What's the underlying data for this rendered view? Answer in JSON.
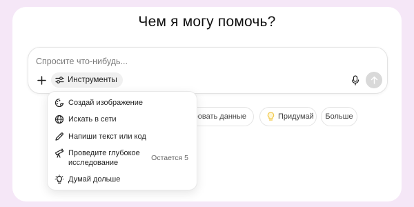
{
  "heading": "Чем я могу помочь?",
  "composer": {
    "placeholder": "Спросите что-нибудь...",
    "tools_label": "Инструменты"
  },
  "chips": {
    "analyze": "зировать данные",
    "invent": "Придумай",
    "more": "Больше"
  },
  "tools_menu": {
    "items": [
      {
        "label": "Создай изображение",
        "icon": "paintbrush-icon"
      },
      {
        "label": "Искать в сети",
        "icon": "globe-icon"
      },
      {
        "label": "Напиши текст или код",
        "icon": "pen-icon"
      },
      {
        "label": "Проведите глубокое исследование",
        "icon": "telescope-icon",
        "badge": "Остается 5"
      },
      {
        "label": "Думай дольше",
        "icon": "lightbulb-icon"
      }
    ]
  },
  "colors": {
    "page_background": "#f5e7f7",
    "card_background": "#ffffff",
    "send_button": "#d9d9d9",
    "idea_accent": "#f2c94c"
  }
}
